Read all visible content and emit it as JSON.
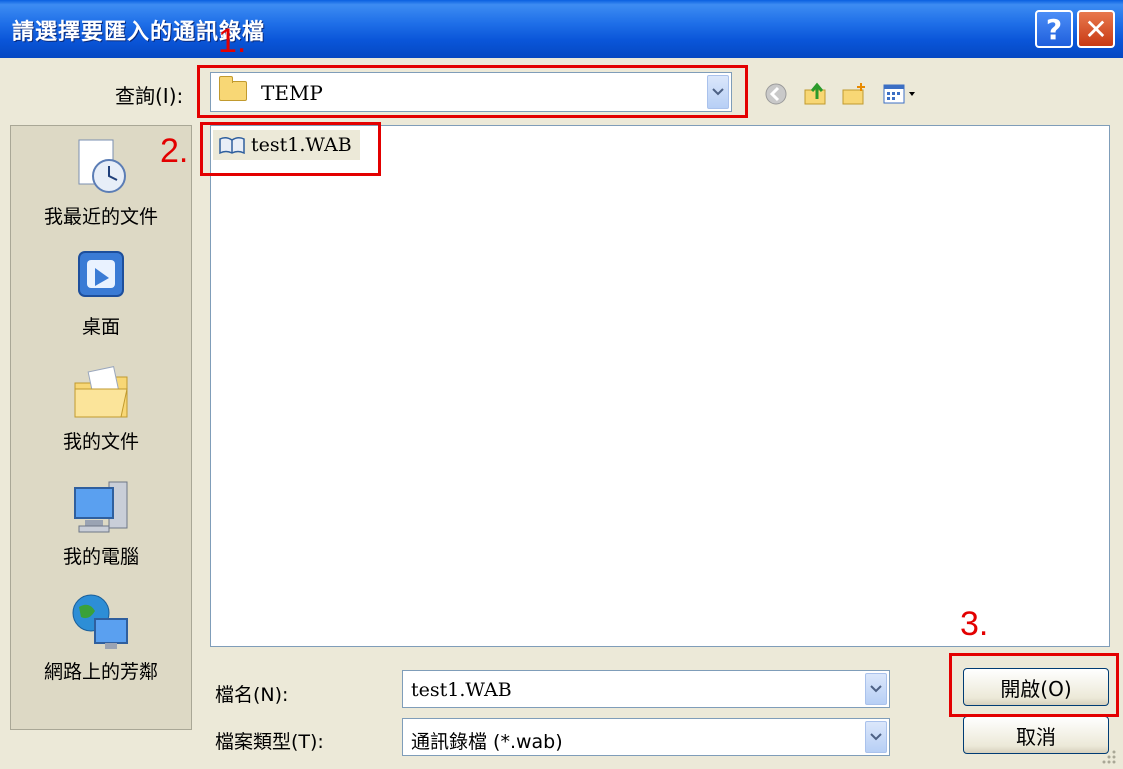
{
  "dialog": {
    "title": "請選擇要匯入的通訊錄檔",
    "help_symbol": "?",
    "close_symbol": "✕"
  },
  "look_in": {
    "label": "查詢(I):",
    "value": "TEMP"
  },
  "toolbar": {
    "icons": [
      "back-icon",
      "up-folder-icon",
      "new-folder-icon",
      "view-menu-icon"
    ]
  },
  "places": [
    {
      "label": "我最近的文件",
      "icon": "recent-documents-icon"
    },
    {
      "label": "桌面",
      "icon": "desktop-icon"
    },
    {
      "label": "我的文件",
      "icon": "my-documents-icon"
    },
    {
      "label": "我的電腦",
      "icon": "my-computer-icon"
    },
    {
      "label": "網路上的芳鄰",
      "icon": "network-places-icon"
    }
  ],
  "files": [
    {
      "name": "test1.WAB",
      "icon": "address-book-icon"
    }
  ],
  "filename": {
    "label": "檔名(N):",
    "value": "test1.WAB"
  },
  "filetype": {
    "label": "檔案類型(T):",
    "value": "通訊錄檔 (*.wab)"
  },
  "buttons": {
    "open": "開啟(O)",
    "cancel": "取消"
  },
  "annotations": [
    "1.",
    "2.",
    "3."
  ],
  "colors": {
    "annotation_red": "#e30000",
    "titlebar_blue": "#0a55d8",
    "dialog_bg": "#ece9d8"
  }
}
